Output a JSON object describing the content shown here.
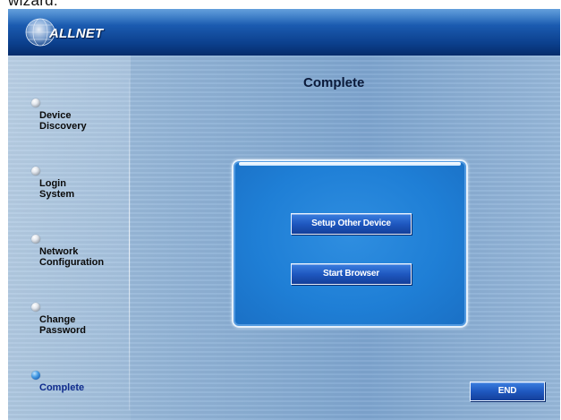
{
  "caption": "wizard:",
  "header": {
    "logo_text": "ALLNET"
  },
  "sidebar": {
    "steps": [
      {
        "label": "Device\nDiscovery",
        "active": false
      },
      {
        "label": "Login\nSystem",
        "active": false
      },
      {
        "label": "Network\nConfiguration",
        "active": false
      },
      {
        "label": "Change\nPassword",
        "active": false
      },
      {
        "label": "Complete",
        "active": true
      }
    ]
  },
  "main": {
    "title": "Complete",
    "setup_other_device_label": "Setup Other Device",
    "start_browser_label": "Start Browser",
    "end_label": "END"
  }
}
